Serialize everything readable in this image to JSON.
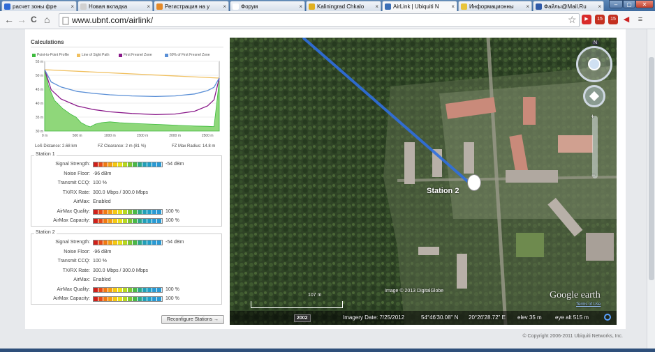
{
  "browser": {
    "tabs": [
      {
        "title": "расчет зоны фре",
        "fav": "#2e6bd6"
      },
      {
        "title": "Новая вкладка",
        "fav": "#d0d0d0"
      },
      {
        "title": "Регистрация на у",
        "fav": "#e48a2a"
      },
      {
        "title": "Форум",
        "fav": "#ffffff"
      },
      {
        "title": "Kaliningrad Chkalo",
        "fav": "#e0b020"
      },
      {
        "title": "AirLink | Ubiquiti N",
        "fav": "#3b6fb6"
      },
      {
        "title": "Информационны",
        "fav": "#e8c43a"
      },
      {
        "title": "Файлы@Mail.Ru",
        "fav": "#2f5aa8"
      }
    ],
    "close_glyph": "×",
    "url": "www.ubnt.com/airlink/",
    "back_glyph": "←",
    "forward_glyph": "→",
    "reload_glyph": "C",
    "home_glyph": "⌂",
    "star_glyph": "☆"
  },
  "calculations": {
    "title": "Calculations",
    "legend": [
      {
        "label": "Point-to-Point Profile",
        "color": "#3dbb3d"
      },
      {
        "label": "Line of Sight Path",
        "color": "#f0c060"
      },
      {
        "label": "First Fresnel Zone",
        "color": "#8a1a8a"
      },
      {
        "label": "60% of First Fresnel Zone",
        "color": "#5a8fd6"
      }
    ],
    "stats": {
      "los_distance": "LoS Distance: 2.68 km",
      "fz_clearance": "FZ Clearance: 2 m  (81 %)",
      "fz_max_radius": "FZ Max Radius: 14.8 m"
    }
  },
  "chart_data": {
    "type": "line",
    "ylim": [
      30,
      55
    ],
    "yticks": [
      "55 m",
      "50 m",
      "45 m",
      "40 m",
      "35 m",
      "30 m"
    ],
    "xlim": [
      0,
      2680
    ],
    "xticks": [
      "0 m",
      "500 m",
      "1000 m",
      "1500 m",
      "2000 m",
      "2500 m"
    ],
    "series": [
      {
        "name": "Point-to-Point Profile",
        "color": "#3dbb3d",
        "fill": true,
        "x": [
          0,
          60,
          150,
          280,
          400,
          480,
          560,
          640,
          700,
          780,
          870,
          1000,
          1150,
          1300,
          1500,
          1700,
          1900,
          2100,
          2300,
          2500,
          2600,
          2680
        ],
        "values": [
          52,
          46,
          41,
          38,
          36,
          35,
          33,
          32,
          31.5,
          32.5,
          33,
          33.3,
          33,
          32.8,
          32.6,
          32.4,
          32.2,
          32,
          31.8,
          31.7,
          31.6,
          48
        ]
      },
      {
        "name": "Line of Sight Path",
        "color": "#f0c060",
        "x": [
          0,
          2680
        ],
        "values": [
          52,
          49
        ]
      },
      {
        "name": "First Fresnel Zone",
        "color": "#8a1a8a",
        "x": [
          0,
          100,
          250,
          500,
          750,
          1000,
          1340,
          1700,
          2000,
          2300,
          2500,
          2600,
          2680
        ],
        "values": [
          52,
          44.8,
          41.5,
          39.0,
          37.7,
          36.9,
          36.3,
          35.9,
          36.1,
          37.1,
          39.0,
          41.2,
          49
        ]
      },
      {
        "name": "60% of First Fresnel Zone",
        "color": "#5a8fd6",
        "x": [
          0,
          100,
          250,
          500,
          750,
          1000,
          1340,
          1700,
          2000,
          2300,
          2500,
          2600,
          2680
        ],
        "values": [
          52,
          47.6,
          45.8,
          44.2,
          43.5,
          43.0,
          42.6,
          42.4,
          42.6,
          43.3,
          44.5,
          45.7,
          49
        ]
      }
    ]
  },
  "stations": [
    {
      "title": "Station 1",
      "signal_strength": "-54 dBm",
      "noise_floor": "-96 dBm",
      "transmit_ccq": "100 %",
      "txrx_rate": "300.0 Mbps / 300.0 Mbps",
      "airmax": "Enabled",
      "airmax_quality": "100 %",
      "airmax_capacity": "100 %"
    },
    {
      "title": "Station 2",
      "signal_strength": "-54 dBm",
      "noise_floor": "-96 dBm",
      "transmit_ccq": "100 %",
      "txrx_rate": "300.0 Mbps / 300.0 Mbps",
      "airmax": "Enabled",
      "airmax_quality": "100 %",
      "airmax_capacity": "100 %"
    }
  ],
  "labels": {
    "signal_strength": "Signal Strength:",
    "noise_floor": "Noise Floor:",
    "transmit_ccq": "Transmit CCQ:",
    "txrx_rate": "TX/RX Rate:",
    "airmax": "AirMax:",
    "airmax_quality": "AirMax Quality:",
    "airmax_capacity": "AirMax Capacity:"
  },
  "signal_bar_colors": [
    "#d0201a",
    "#e54a16",
    "#f07a12",
    "#f3a012",
    "#f5c812",
    "#e8e11a",
    "#b8d820",
    "#7ec830",
    "#4cb848",
    "#2ea88a",
    "#22a0b8",
    "#20a0c8",
    "#2a9ad4",
    "#2a9ad4"
  ],
  "reconfigure_button": "Reconfigure Stations →",
  "copyright": "© Copyright 2006-2011 Ubiquiti Networks, Inc.",
  "map": {
    "station_label": "Station 2",
    "scale_label": "107 m",
    "year_label": "2002",
    "imagery_credit": "Image © 2013 DigitalGlobe",
    "logo_text": "Google earth",
    "terms_link": "Terms of Use",
    "imagery_date": "Imagery Date: 7/25/2012",
    "latitude": "54°46'30.08\" N",
    "longitude": "20°26'28.72\" E",
    "elev": "elev   35 m",
    "eye_alt": "eye alt   515 m",
    "compass_n": "N",
    "zoom_plus": "+",
    "zoom_minus": "−"
  }
}
